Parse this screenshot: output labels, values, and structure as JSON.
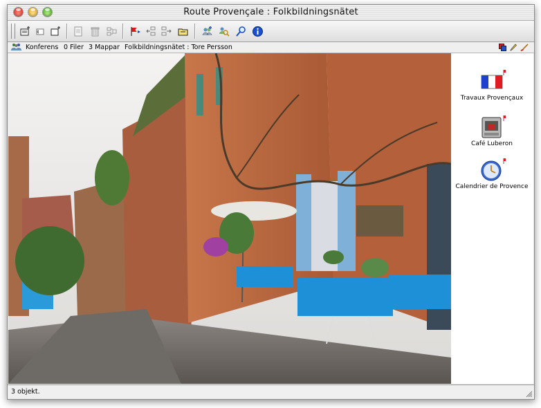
{
  "window": {
    "title": "Route Provençale : Folkbildningsnätet"
  },
  "toolbar": {
    "buttons": [
      {
        "name": "new-message-icon"
      },
      {
        "name": "reply-icon"
      },
      {
        "name": "new-window-icon"
      },
      {
        "name": "print-icon"
      },
      {
        "name": "trash-icon"
      },
      {
        "name": "organize-icon"
      },
      {
        "name": "mark-flag-icon"
      },
      {
        "name": "previous-icon"
      },
      {
        "name": "next-icon"
      },
      {
        "name": "open-folder-icon"
      },
      {
        "name": "add-members-icon"
      },
      {
        "name": "search-members-icon"
      },
      {
        "name": "search-icon"
      },
      {
        "name": "info-icon"
      }
    ]
  },
  "infobar": {
    "type_label": "Konferens",
    "files": "0 Filer",
    "folders": "3 Mappar",
    "path": "Folkbildningsnätet : Tore Persson"
  },
  "items": [
    {
      "label": "Travaux Provençaux",
      "icon": "french-flag-icon"
    },
    {
      "label": "Café Luberon",
      "icon": "coffee-machine-icon"
    },
    {
      "label": "Calendrier de Provence",
      "icon": "clock-icon"
    }
  ],
  "status": {
    "text": "3 objekt."
  },
  "colors": {
    "title_bar": "#e6e6e6",
    "tablecloth_blue": "#1e90d8",
    "shutter_blue": "#7fb0d8",
    "stone_wall": "#b06a3f"
  }
}
